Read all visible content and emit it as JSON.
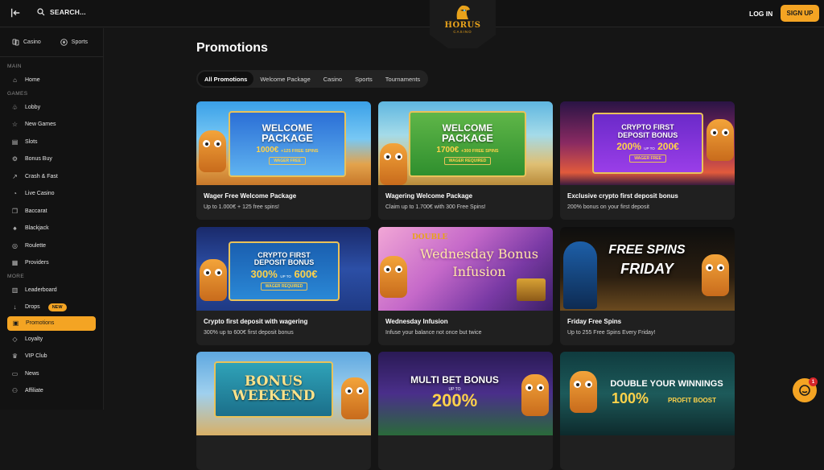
{
  "header": {
    "search_label": "SEARCH...",
    "logo_text": "HORUS",
    "logo_sub": "CASINO",
    "login_label": "LOG IN",
    "signup_label": "SIGN UP"
  },
  "sidebar": {
    "top": [
      {
        "label": "Casino",
        "icon": "casino-icon"
      },
      {
        "label": "Sports",
        "icon": "sports-icon"
      }
    ],
    "section_main": "MAIN",
    "main_items": [
      {
        "label": "Home",
        "icon": "home-icon"
      }
    ],
    "section_games": "GAMES",
    "games_items": [
      {
        "label": "Lobby",
        "icon": "lobby-icon"
      },
      {
        "label": "New Games",
        "icon": "star-icon"
      },
      {
        "label": "Slots",
        "icon": "slots-icon"
      },
      {
        "label": "Bonus Buy",
        "icon": "bonus-buy-icon"
      },
      {
        "label": "Crash & Fast",
        "icon": "rocket-icon"
      },
      {
        "label": "Live Casino",
        "icon": "live-icon"
      },
      {
        "label": "Baccarat",
        "icon": "baccarat-icon"
      },
      {
        "label": "Blackjack",
        "icon": "blackjack-icon"
      },
      {
        "label": "Roulette",
        "icon": "roulette-icon"
      },
      {
        "label": "Providers",
        "icon": "providers-icon"
      }
    ],
    "section_more": "MORE",
    "more_items": [
      {
        "label": "Leaderboard",
        "icon": "leaderboard-icon"
      },
      {
        "label": "Drops",
        "icon": "drops-icon",
        "badge": "NEW"
      },
      {
        "label": "Promotions",
        "icon": "promotions-icon"
      },
      {
        "label": "Loyalty",
        "icon": "diamond-icon"
      },
      {
        "label": "VIP Club",
        "icon": "crown-icon"
      },
      {
        "label": "News",
        "icon": "news-icon"
      },
      {
        "label": "Affiliate",
        "icon": "affiliate-icon"
      }
    ]
  },
  "main": {
    "title": "Promotions",
    "tabs": [
      "All Promotions",
      "Welcome Package",
      "Casino",
      "Sports",
      "Tournaments"
    ],
    "active_tab": "All Promotions",
    "cards": [
      {
        "title": "Wager Free Welcome Package",
        "desc": "Up to 1.000€ + 125 free spins!",
        "banner_line1": "WELCOME",
        "banner_line2": "PACKAGE",
        "banner_amount": "1000€",
        "banner_extra": "+125 FREE SPINS",
        "banner_pill": "WAGER FREE"
      },
      {
        "title": "Wagering Welcome Package",
        "desc": "Claim up to 1.700€ with 300 Free Spins!",
        "banner_line1": "WELCOME",
        "banner_line2": "PACKAGE",
        "banner_amount": "1700€",
        "banner_extra": "+300 FREE SPINS",
        "banner_pill": "WAGER REQUIRED"
      },
      {
        "title": "Exclusive crypto first deposit bonus",
        "desc": "200% bonus on your first deposit",
        "banner_line1": "CRYPTO FIRST",
        "banner_line2": "DEPOSIT BONUS",
        "banner_amount": "200%",
        "banner_upto": "UP TO",
        "banner_amount2": "200€",
        "banner_pill": "WAGER FREE"
      },
      {
        "title": "Crypto first deposit with wagering",
        "desc": "300% up to 600€ first deposit bonus",
        "banner_line1": "CRYPTO FIRST",
        "banner_line2": "DEPOSIT BONUS",
        "banner_amount": "300%",
        "banner_upto": "UP TO",
        "banner_amount2": "600€",
        "banner_pill": "WAGER REQUIRED"
      },
      {
        "title": "Wednesday Infusion",
        "desc": "Infuse your balance not once but twice",
        "banner_tag": "DOUBLE",
        "banner_line1": "Wednesday Bonus",
        "banner_line2": "Infusion"
      },
      {
        "title": "Friday Free Spins",
        "desc": "Up to 255 Free Spins Every Friday!",
        "banner_line1": "FREE SPINS",
        "banner_line2": "FRIDAY"
      },
      {
        "banner_line1": "BONUS",
        "banner_line2": "WEEKEND"
      },
      {
        "banner_line1": "MULTI BET BONUS",
        "banner_upto": "UP TO",
        "banner_amount": "200%"
      },
      {
        "banner_line1": "DOUBLE YOUR WINNINGS",
        "banner_amount": "100%",
        "banner_extra": "PROFIT BOOST"
      }
    ]
  },
  "chat": {
    "count": "1"
  },
  "colors": {
    "accent": "#f4a423",
    "background": "#151515",
    "card": "#202020"
  }
}
